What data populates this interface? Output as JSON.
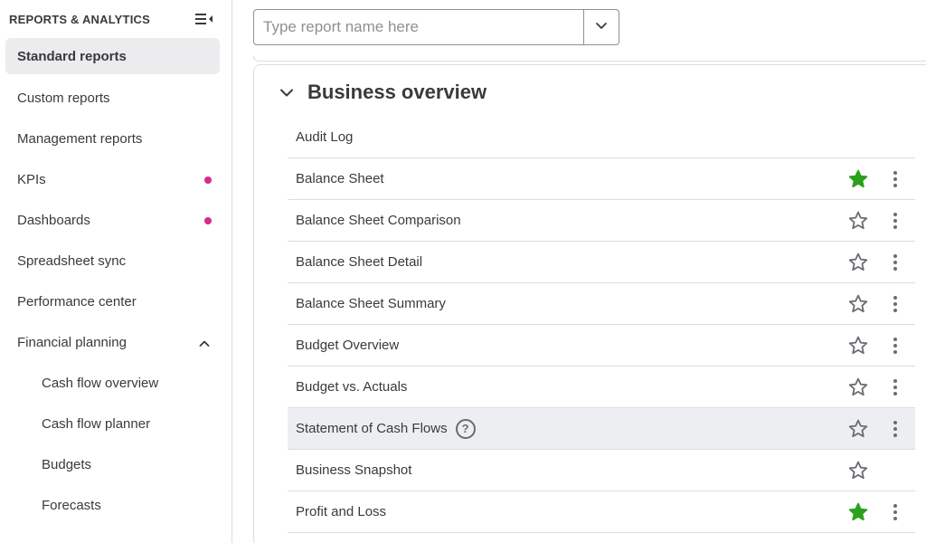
{
  "sidebar": {
    "title": "REPORTS & ANALYTICS",
    "items": [
      {
        "label": "Standard reports"
      },
      {
        "label": "Custom reports"
      },
      {
        "label": "Management reports"
      },
      {
        "label": "KPIs"
      },
      {
        "label": "Dashboards"
      },
      {
        "label": "Spreadsheet sync"
      },
      {
        "label": "Performance center"
      },
      {
        "label": "Financial planning"
      },
      {
        "label": "Cash flow overview"
      },
      {
        "label": "Cash flow planner"
      },
      {
        "label": "Budgets"
      },
      {
        "label": "Forecasts"
      }
    ]
  },
  "search": {
    "placeholder": "Type report name here",
    "value": ""
  },
  "section": {
    "title": "Business overview",
    "reports": [
      {
        "label": "Audit Log"
      },
      {
        "label": "Balance Sheet",
        "favorite": true
      },
      {
        "label": "Balance Sheet Comparison",
        "favorite": false
      },
      {
        "label": "Balance Sheet Detail",
        "favorite": false
      },
      {
        "label": "Balance Sheet Summary",
        "favorite": false
      },
      {
        "label": "Budget Overview",
        "favorite": false
      },
      {
        "label": "Budget vs. Actuals",
        "favorite": false
      },
      {
        "label": "Statement of Cash Flows",
        "favorite": false,
        "help": "?"
      },
      {
        "label": "Business Snapshot",
        "favorite": false
      },
      {
        "label": "Profit and Loss",
        "favorite": true
      }
    ]
  },
  "colors": {
    "accent_green": "#2ca01c",
    "notification_dot": "#d52b8b",
    "icon_gray": "#6b6c72"
  },
  "icons": {
    "collapse": "collapse-menu-icon",
    "dropdown": "chevron-down-icon",
    "section_toggle": "chevron-down-icon",
    "favorite": "star-icon",
    "more": "kebab-menu-icon",
    "help": "help-circle-icon"
  }
}
